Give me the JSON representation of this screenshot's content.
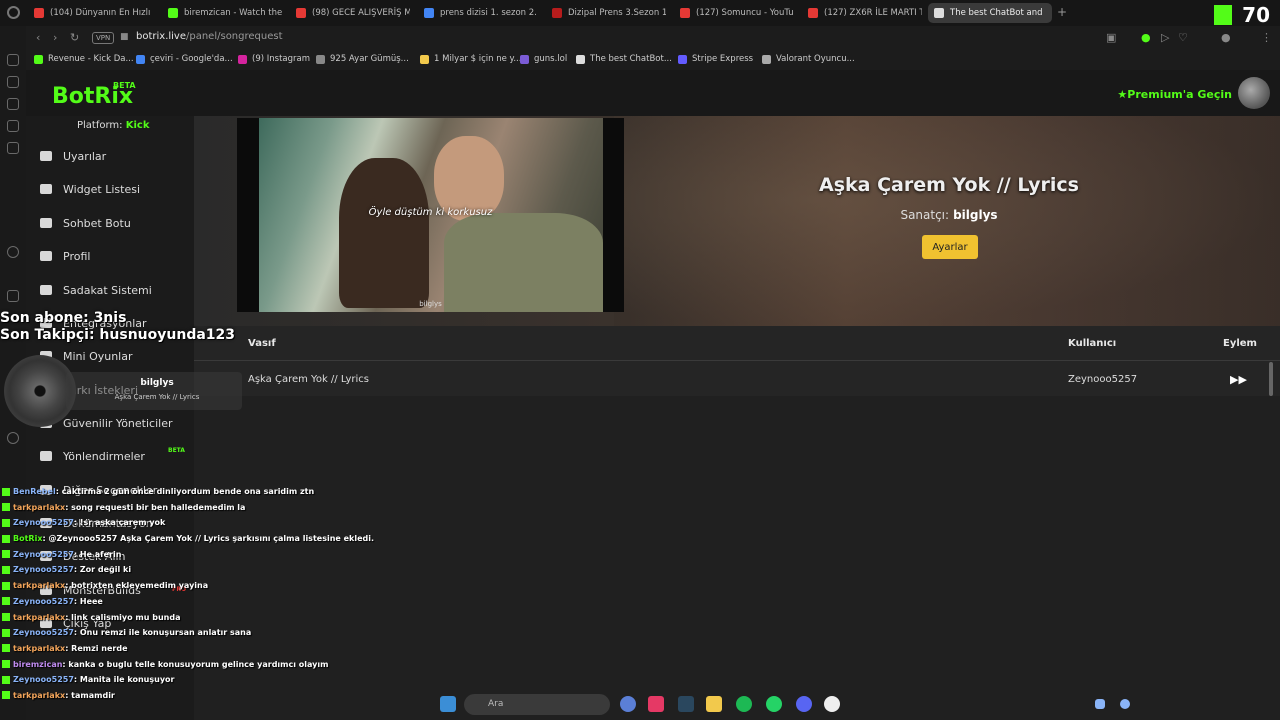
{
  "tabs": [
    {
      "label": "(104) Dünyanın En Hızlı A",
      "color": "#e53935"
    },
    {
      "label": "biremzican - Watch the V",
      "color": "#53fc18"
    },
    {
      "label": "(98) GECE ALIŞVERİŞ ME",
      "color": "#e53935"
    },
    {
      "label": "prens dizisi 1. sezon 2. b",
      "color": "#4285f4"
    },
    {
      "label": "Dizipal Prens 3.Sezon 1.B",
      "color": "#b71c1c"
    },
    {
      "label": "(127) Somuncu - YouTube",
      "color": "#e53935"
    },
    {
      "label": "(127) ZX6R İLE MARTI TA",
      "color": "#e53935"
    },
    {
      "label": "The best ChatBot and",
      "color": "#dddddd"
    }
  ],
  "kick_counter": "70",
  "address": {
    "vpn": "VPN",
    "host": "botrix.live",
    "path": "/panel/songrequest"
  },
  "bookmarks": [
    {
      "label": "Revenue - Kick Da...",
      "color": "#53fc18"
    },
    {
      "label": "çeviri - Google'da...",
      "color": "#4285f4"
    },
    {
      "label": "(9) Instagram",
      "color": "#d6249f"
    },
    {
      "label": "925 Ayar Gümüş...",
      "color": "#888888"
    },
    {
      "label": "1 Milyar $ için ne y...",
      "color": "#f2c94c"
    },
    {
      "label": "guns.lol",
      "color": "#7b5cd6"
    },
    {
      "label": "The best ChatBot...",
      "color": "#dddddd"
    },
    {
      "label": "Stripe Express",
      "color": "#635bff"
    },
    {
      "label": "Valorant Oyuncu...",
      "color": "#aaaaaa"
    }
  ],
  "header": {
    "logo": "BotRix",
    "beta": "BETA",
    "premium": "Premium'a Geçin"
  },
  "sidebar": {
    "platform_label": "Platform:",
    "platform_value": "Kick",
    "items": [
      {
        "label": "Uyarılar"
      },
      {
        "label": "Widget Listesi"
      },
      {
        "label": "Sohbet Botu"
      },
      {
        "label": "Profil"
      },
      {
        "label": "Sadakat Sistemi"
      },
      {
        "label": "Entegrasyonlar"
      },
      {
        "label": "Mini Oyunlar"
      },
      {
        "label": "Şarkı İstekleri"
      },
      {
        "label": "Güvenilir Yöneticiler"
      },
      {
        "label": "Yönlendirmeler"
      },
      {
        "label": "Diğer Seçenekler"
      },
      {
        "label": "Dokümantasyon"
      },
      {
        "label": "Destek Alın"
      },
      {
        "label": "MonsterBuilds"
      },
      {
        "label": "Çıkış Yap"
      }
    ],
    "beta_tag": "BETA",
    "pro_tag": "PRO"
  },
  "player": {
    "subtitle": "Öyle düştüm ki korkusuz",
    "watermark": "bilglys",
    "song_title": "Aşka Çarem Yok // Lyrics",
    "artist_label": "Sanatçı:",
    "artist_value": "bilglys",
    "settings_button": "Ayarlar"
  },
  "table": {
    "headers": {
      "title": "Vasıf",
      "user": "Kullanıcı",
      "action": "Eylem"
    },
    "rows": [
      {
        "title": "Aşka Çarem Yok // Lyrics",
        "user": "Zeynooo5257"
      }
    ]
  },
  "overlay": {
    "last_sub": "Son abone: 3nis",
    "last_follower": "Son Takipçi: husnuoyunda123",
    "now_playing_artist": "bilglys",
    "now_playing_title": "Aşka Çarem Yok // Lyrics"
  },
  "chat": [
    {
      "user": "BenRebel",
      "msg": ": caktirma 2 gün önce dinliyordum bende ona saridim ztn",
      "cls": "u-blue"
    },
    {
      "user": "tarkparlakx",
      "msg": ": song requesti bir ben halledemedim la",
      "cls": "u-orange"
    },
    {
      "user": "Zeynooo5257",
      "msg": ": !sr aşka çarem yok",
      "cls": "u-blue"
    },
    {
      "user": "BotRix",
      "msg": ": @Zeynooo5257 Aşka Çarem Yok // Lyrics şarkısını çalma listesine ekledi.",
      "cls": "u-green"
    },
    {
      "user": "Zeynooo5257",
      "msg": ": He aferin",
      "cls": "u-blue"
    },
    {
      "user": "Zeynooo5257",
      "msg": ": Zor değil ki",
      "cls": "u-blue"
    },
    {
      "user": "tarkparlakx",
      "msg": ": botrixten ekleyemedim yayina",
      "cls": "u-orange"
    },
    {
      "user": "Zeynooo5257",
      "msg": ": Heee",
      "cls": "u-blue"
    },
    {
      "user": "tarkparlakx",
      "msg": ": link calismiyo mu bunda",
      "cls": "u-orange"
    },
    {
      "user": "Zeynooo5257",
      "msg": ": Onu remzi ile konuşursan anlatır sana",
      "cls": "u-blue"
    },
    {
      "user": "tarkparlakx",
      "msg": ": Remzi nerde",
      "cls": "u-orange"
    },
    {
      "user": "biremzican",
      "msg": ": kanka o buglu telle konusuyorum gelince yardımcı olayım",
      "cls": "u-purple"
    },
    {
      "user": "Zeynooo5257",
      "msg": ": Manita ile konuşuyor",
      "cls": "u-blue"
    },
    {
      "user": "tarkparlakx",
      "msg": ": tamamdir",
      "cls": "u-orange"
    }
  ],
  "taskbar": {
    "search_placeholder": "Ara"
  }
}
